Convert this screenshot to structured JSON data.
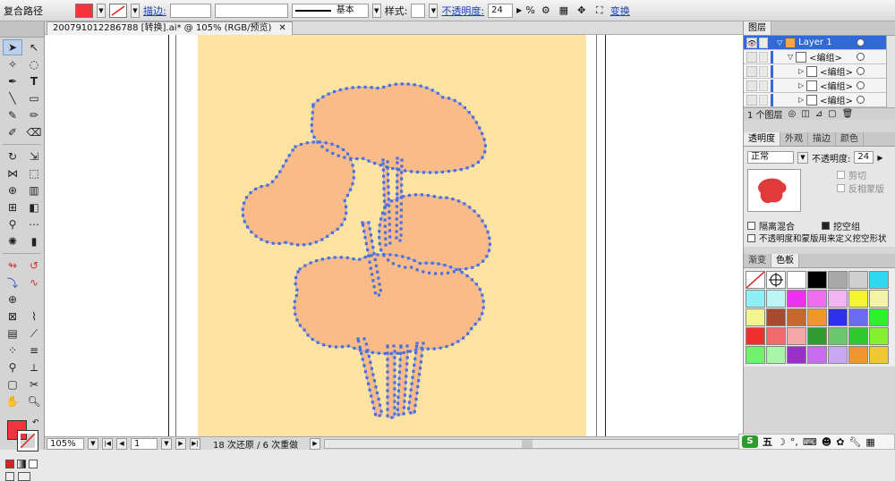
{
  "control_bar": {
    "object_label": "复合路径",
    "fill_color": "#f2343c",
    "stroke_label": "描边:",
    "stroke_weight": "",
    "brush_label": "",
    "stroke_profile_label": "基本",
    "style_label": "样式:",
    "opacity_label": "不透明度:",
    "opacity_value": "24",
    "opacity_unit": "%",
    "transform_label": "变换"
  },
  "document": {
    "tab_title": "200791012286788 [转换].ai* @ 105% (RGB/预览)",
    "close_glyph": "✕",
    "artboard_color": "#fde3a1",
    "art_fill": "#f9bc88",
    "anchor_color": "#4a6ee0"
  },
  "status_bar": {
    "zoom": "105%",
    "artboard_index": "1",
    "history_text": "18 次还原 / 6 次重做"
  },
  "layers_panel": {
    "tab_label": "图层",
    "rows": [
      {
        "name": "Layer 1",
        "selected": true
      },
      {
        "name": "<编组>",
        "selected": false
      },
      {
        "name": "<编组>",
        "selected": false
      },
      {
        "name": "<编组>",
        "selected": false
      },
      {
        "name": "<编组>",
        "selected": false
      }
    ],
    "footer_text": "1 个图层"
  },
  "transparency_panel": {
    "tabs": [
      "透明度",
      "外观",
      "描边",
      "颜色"
    ],
    "blend_mode": "正常",
    "opacity_label": "不透明度:",
    "opacity_value": "24",
    "clip_label": "剪切",
    "invert_mask_label": "反相蒙版",
    "isolate_blend_label": "隔离混合",
    "knockout_label": "挖空组",
    "opacity_mask_label": "不透明度和蒙版用来定义挖空形状"
  },
  "swatches_panel": {
    "tabs": [
      "渐变",
      "色板"
    ],
    "colors": [
      "none",
      "register",
      "#ffffff",
      "#000000",
      "#a9a9a9",
      "#cfcfcf",
      "#2fd8f0",
      "#8ef0f4",
      "#bdf4f4",
      "#f02ff0",
      "#f06cf0",
      "#f4b4f4",
      "#f4f42f",
      "#f4f4a8",
      "#f4f48e",
      "#a84a2f",
      "#c8682f",
      "#f0962f",
      "#2f2ff0",
      "#6c6cf0",
      "#2ff02f",
      "#f02f2f",
      "#f06c6c",
      "#f4a8a8",
      "#2f9a2f",
      "#6cc86c",
      "#2fc82f",
      "#86f02f",
      "#6cf46c",
      "#a8f4a8",
      "#9a2fc8",
      "#c86cf0",
      "#c8a8f0",
      "#f0962f",
      "#f0c82f"
    ]
  },
  "tray": {
    "ime_label": "五"
  }
}
